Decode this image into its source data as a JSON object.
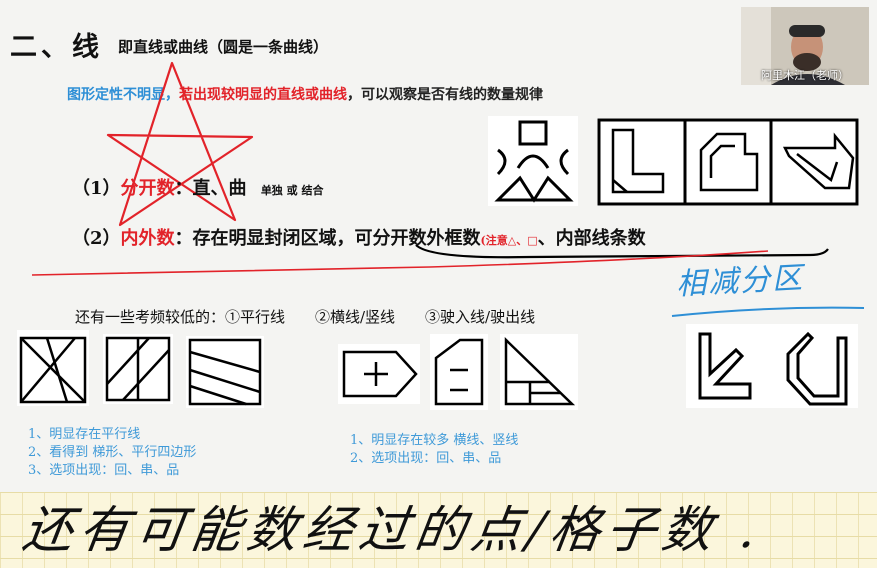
{
  "heading": {
    "title": "二、线",
    "subtitle": "即直线或曲线（圆是一条曲线）"
  },
  "tip": {
    "part1": "图形定性不明显，",
    "part2": "若出现较明显的直线或曲线",
    "part3": "，可以观察是否有线的数量规律"
  },
  "video": {
    "label": "阿里木江（老师）"
  },
  "items": {
    "one": {
      "num": "（1）",
      "key": "分开数",
      "colon": "：",
      "text": "直、曲",
      "small": "单独 或 结合"
    },
    "two": {
      "num": "（2）",
      "key": "内外数",
      "text1": "：存在明显封闭区域，",
      "text2": "可分开数外框数",
      "small": "(注意△、□",
      "text3": "、内部线条数"
    }
  },
  "handwriting": {
    "right_note": "相减分区",
    "bottom_note": "还有可能数经过的点/格子数 ."
  },
  "low_freq": {
    "text": "还有一些考频较低的：①平行线　　②横线/竖线　　③驶入线/驶出线"
  },
  "notes_parallel": [
    "1、明显存在平行线",
    "2、看得到 梯形、平行四边形",
    "3、选项出现：回、串、品"
  ],
  "notes_hv": [
    "1、明显存在较多 横线、竖线",
    "2、选项出现：回、串、品"
  ]
}
